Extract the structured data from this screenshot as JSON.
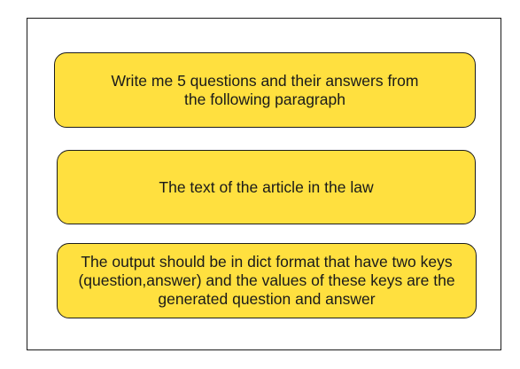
{
  "diagram": {
    "boxes": [
      {
        "text": "Write me 5 questions and their answers from the following paragraph"
      },
      {
        "text": "The text of the article in the law"
      },
      {
        "text": "The output should be in dict format that have two keys (question,answer) and the values of these keys are the generated question and answer"
      }
    ],
    "colors": {
      "box_fill": "#ffe03f",
      "box_border": "#1c1c1c",
      "frame_border": "#1a1a1a",
      "background": "#ffffff"
    }
  }
}
